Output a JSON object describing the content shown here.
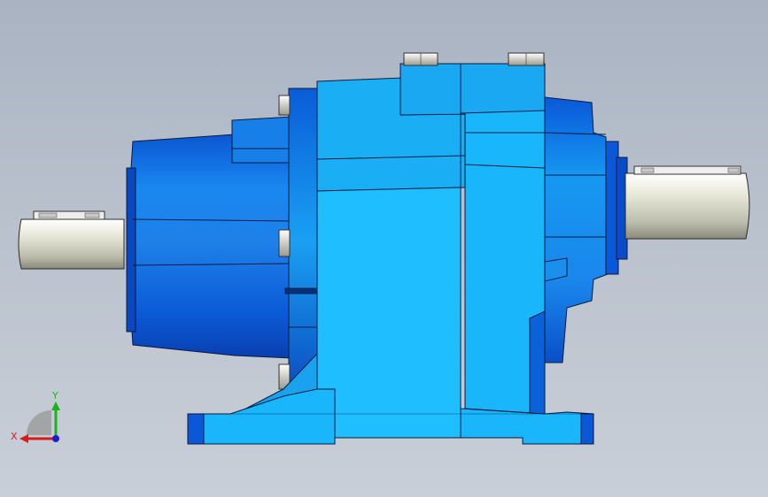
{
  "viewport": {
    "model": "gear reducer",
    "view": "front"
  },
  "triad": {
    "x_label": "X",
    "y_label": "Y",
    "x_color": "#d81b1b",
    "y_color": "#1bb31b",
    "z_color": "#1b1bd8"
  },
  "colors": {
    "body_light": "#1ebeff",
    "body_mid": "#1a8fe6",
    "body_dark": "#0a4fc8",
    "shaft": "#d9d9c8",
    "edge": "#0a1a40"
  }
}
